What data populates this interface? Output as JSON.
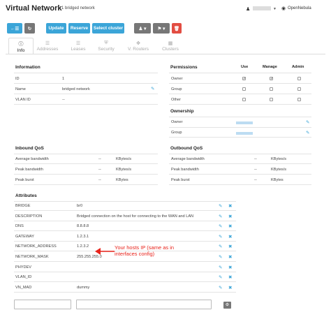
{
  "header": {
    "title": "Virtual Network",
    "subtitle": "1 bridged network",
    "zone": "OpenNebula"
  },
  "toolbar": {
    "update": "Update",
    "reserve": "Reserve",
    "select_cluster": "Select cluster"
  },
  "tabs": [
    {
      "label": "Info",
      "icon": "info-icon"
    },
    {
      "label": "Addresses",
      "icon": "list-icon"
    },
    {
      "label": "Leases",
      "icon": "list-icon"
    },
    {
      "label": "Security",
      "icon": "shield-icon"
    },
    {
      "label": "V. Routers",
      "icon": "routers-icon"
    },
    {
      "label": "Clusters",
      "icon": "clusters-icon"
    }
  ],
  "information": {
    "title": "Information",
    "rows": [
      {
        "label": "ID",
        "value": "1"
      },
      {
        "label": "Name",
        "value": "bridged network"
      },
      {
        "label": "VLAN ID",
        "value": "--"
      }
    ]
  },
  "permissions": {
    "title": "Permissions",
    "cols": [
      "Use",
      "Manage",
      "Admin"
    ],
    "rows": [
      {
        "label": "Owner",
        "checks": [
          true,
          true,
          false
        ]
      },
      {
        "label": "Group",
        "checks": [
          false,
          false,
          false
        ]
      },
      {
        "label": "Other",
        "checks": [
          false,
          false,
          false
        ]
      }
    ]
  },
  "ownership": {
    "title": "Ownership",
    "rows": [
      {
        "label": "Owner"
      },
      {
        "label": "Group"
      }
    ]
  },
  "inbound_qos": {
    "title": "Inbound QoS",
    "rows": [
      {
        "label": "Average bandwidth",
        "value": "--",
        "unit": "KBytes/s"
      },
      {
        "label": "Peak bandwidth",
        "value": "--",
        "unit": "KBytes/s"
      },
      {
        "label": "Peak burst",
        "value": "--",
        "unit": "KBytes"
      }
    ]
  },
  "outbound_qos": {
    "title": "Outbound QoS",
    "rows": [
      {
        "label": "Average bandwidth",
        "value": "--",
        "unit": "KBytes/s"
      },
      {
        "label": "Peak bandwidth",
        "value": "--",
        "unit": "KBytes/s"
      },
      {
        "label": "Peak burst",
        "value": "--",
        "unit": "KBytes"
      }
    ]
  },
  "attributes": {
    "title": "Attributes",
    "rows": [
      {
        "key": "BRIDGE",
        "value": "br0"
      },
      {
        "key": "DESCRIPTION",
        "value": "Bridged connection on the host for connecting to the WAN and LAN"
      },
      {
        "key": "DNS",
        "value": "8.8.8.8"
      },
      {
        "key": "GATEWAY",
        "value": "1.2.3.1"
      },
      {
        "key": "NETWORK_ADDRESS",
        "value": "1.2.3.2"
      },
      {
        "key": "NETWORK_MASK",
        "value": "255.255.255.0"
      },
      {
        "key": "PHYDEV",
        "value": ""
      },
      {
        "key": "VLAN_ID",
        "value": ""
      },
      {
        "key": "VN_MAD",
        "value": "dummy"
      }
    ]
  },
  "annotation": {
    "line1": "Your hosts IP (same as in",
    "line2": "interfaces config)",
    "color": "#e8231b"
  },
  "colors": {
    "accent": "#3ba5d8",
    "grey_button": "#777777",
    "danger": "#e24d42"
  }
}
